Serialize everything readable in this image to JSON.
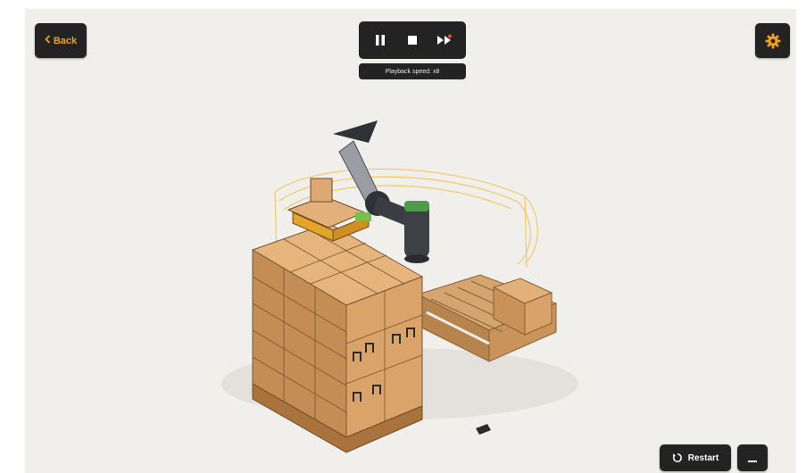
{
  "header": {
    "back_label": "Back",
    "playback_speed_label": "Playback speed: x8"
  },
  "player": {
    "pause_icon": "pause-icon",
    "stop_icon": "stop-icon",
    "fast_forward_icon": "fast-forward-icon"
  },
  "footer": {
    "restart_label": "Restart",
    "more_icon": "minus-icon"
  },
  "colors": {
    "accent": "#f2a01a",
    "button_bg": "#232323",
    "viewport_bg": "#f1efeb",
    "box": "#d9a06b",
    "pallet": "#c8945c"
  },
  "scene": {
    "objects": [
      "robot-arm",
      "box-stack",
      "empty-pallet",
      "gripper",
      "safety-zone"
    ]
  }
}
